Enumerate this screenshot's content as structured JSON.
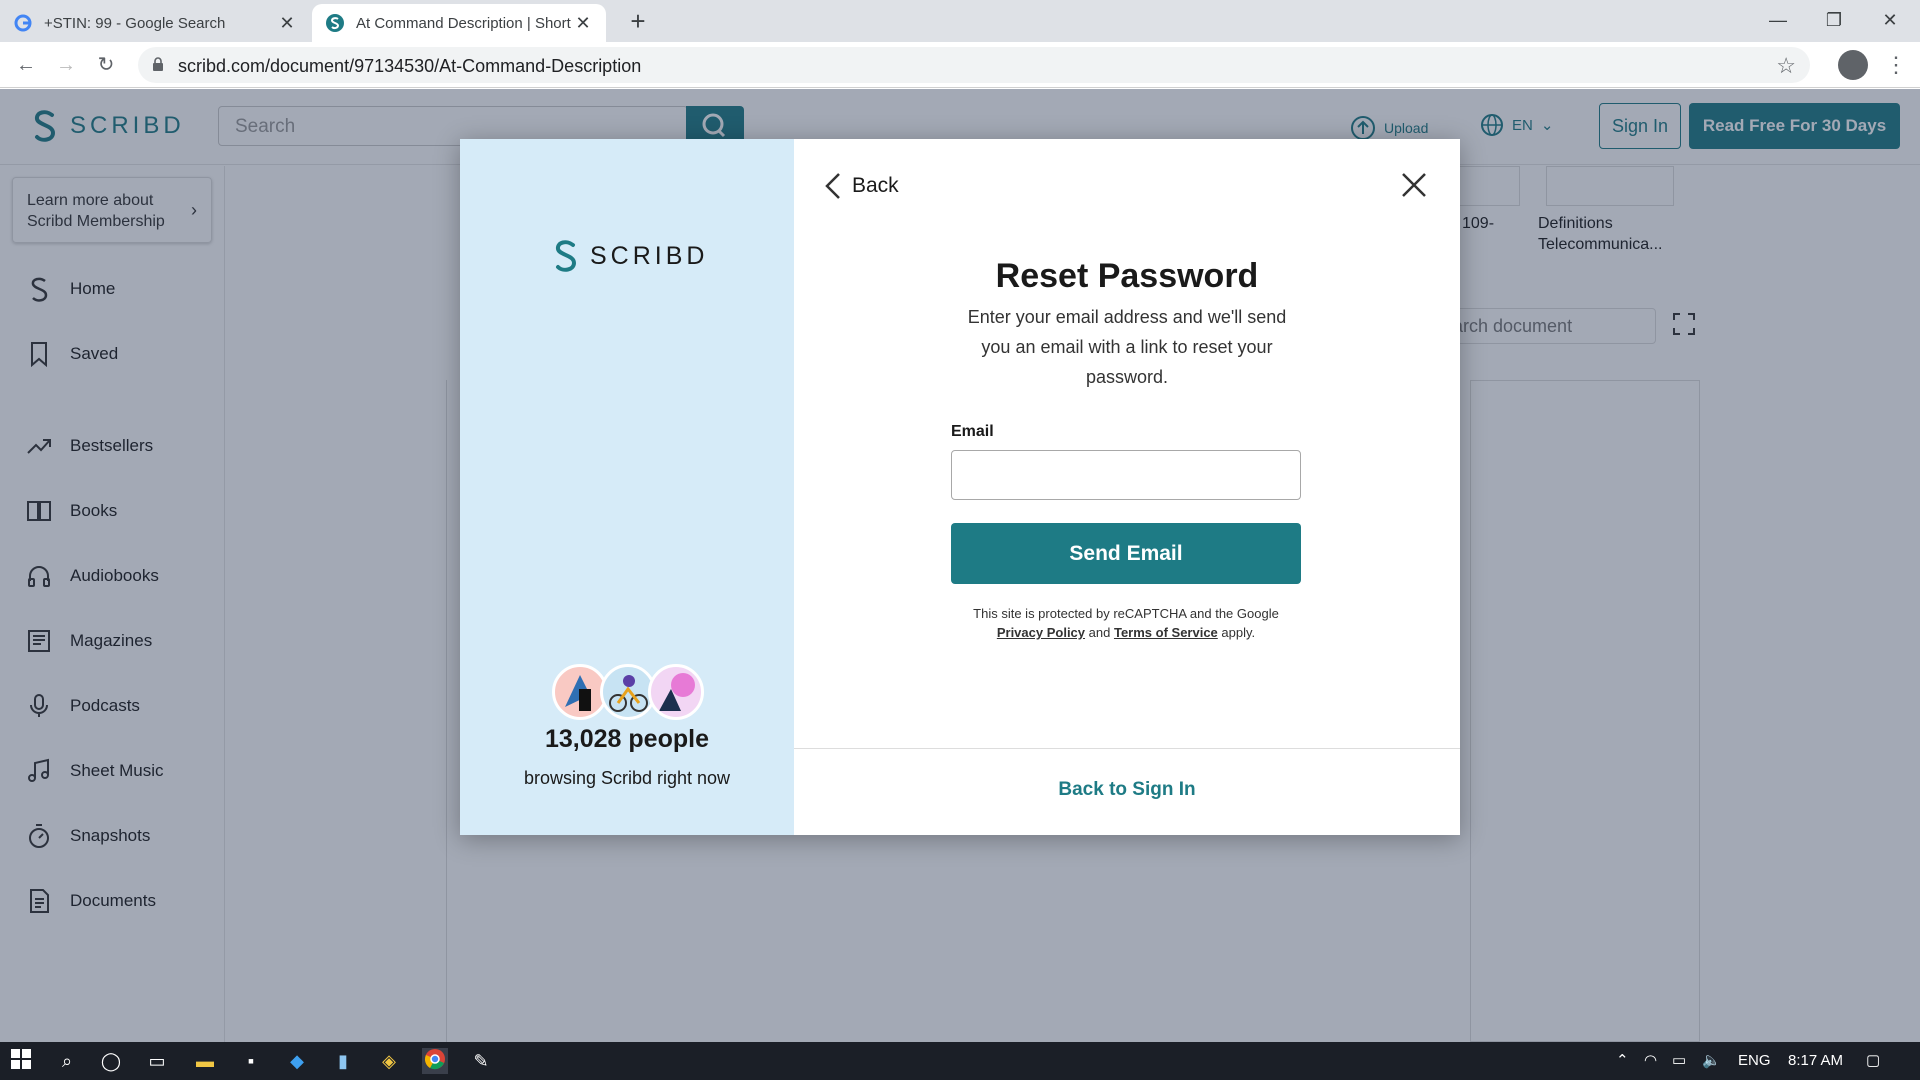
{
  "browser": {
    "tabs": [
      {
        "title": "+STIN: 99 - Google Search",
        "favicon": "google-icon"
      },
      {
        "title": "At Command Description | Short",
        "favicon": "scribd-icon"
      }
    ],
    "url": "scribd.com/document/97134530/At-Command-Description"
  },
  "header": {
    "brand": "SCRIBD",
    "search_placeholder": "Search",
    "upload_label": "Upload",
    "lang_label": "EN",
    "signin_label": "Sign In",
    "readfree_label": "Read Free For 30 Days"
  },
  "sidebar": {
    "learn_more": "Learn more about Scribd Membership",
    "items": [
      {
        "label": "Home",
        "icon": "scribd-icon"
      },
      {
        "label": "Saved",
        "icon": "bookmark-icon"
      },
      {
        "label": "Bestsellers",
        "icon": "trending-icon"
      },
      {
        "label": "Books",
        "icon": "book-icon"
      },
      {
        "label": "Audiobooks",
        "icon": "headphones-icon"
      },
      {
        "label": "Magazines",
        "icon": "magazine-icon"
      },
      {
        "label": "Podcasts",
        "icon": "microphone-icon"
      },
      {
        "label": "Sheet Music",
        "icon": "music-note-icon"
      },
      {
        "label": "Snapshots",
        "icon": "stopwatch-icon"
      },
      {
        "label": "Documents",
        "icon": "document-icon"
      }
    ]
  },
  "background_doc": {
    "related_1_label": "109-",
    "related_2_label": "Definitions Telecommunica...",
    "search_placeholder": "arch document"
  },
  "modal": {
    "brand": "SCRIBD",
    "people_count": "13,028 people",
    "people_sub": "browsing Scribd right now",
    "back_label": "Back",
    "title": "Reset Password",
    "description": "Enter your email address and we'll send you an email with a link to reset your password.",
    "email_label": "Email",
    "email_value": "",
    "send_label": "Send Email",
    "recaptcha_text": "This site is protected by reCAPTCHA and the Google",
    "privacy_link": "Privacy Policy",
    "and_text": "and",
    "terms_link": "Terms of Service",
    "apply_text": "apply.",
    "back_to_signin": "Back to Sign In"
  },
  "taskbar": {
    "lang": "ENG",
    "time": "8:17 AM"
  },
  "colors": {
    "brand": "#1e7b85",
    "modal_left_bg": "#d6ebf8",
    "overlay": "#23314f"
  }
}
